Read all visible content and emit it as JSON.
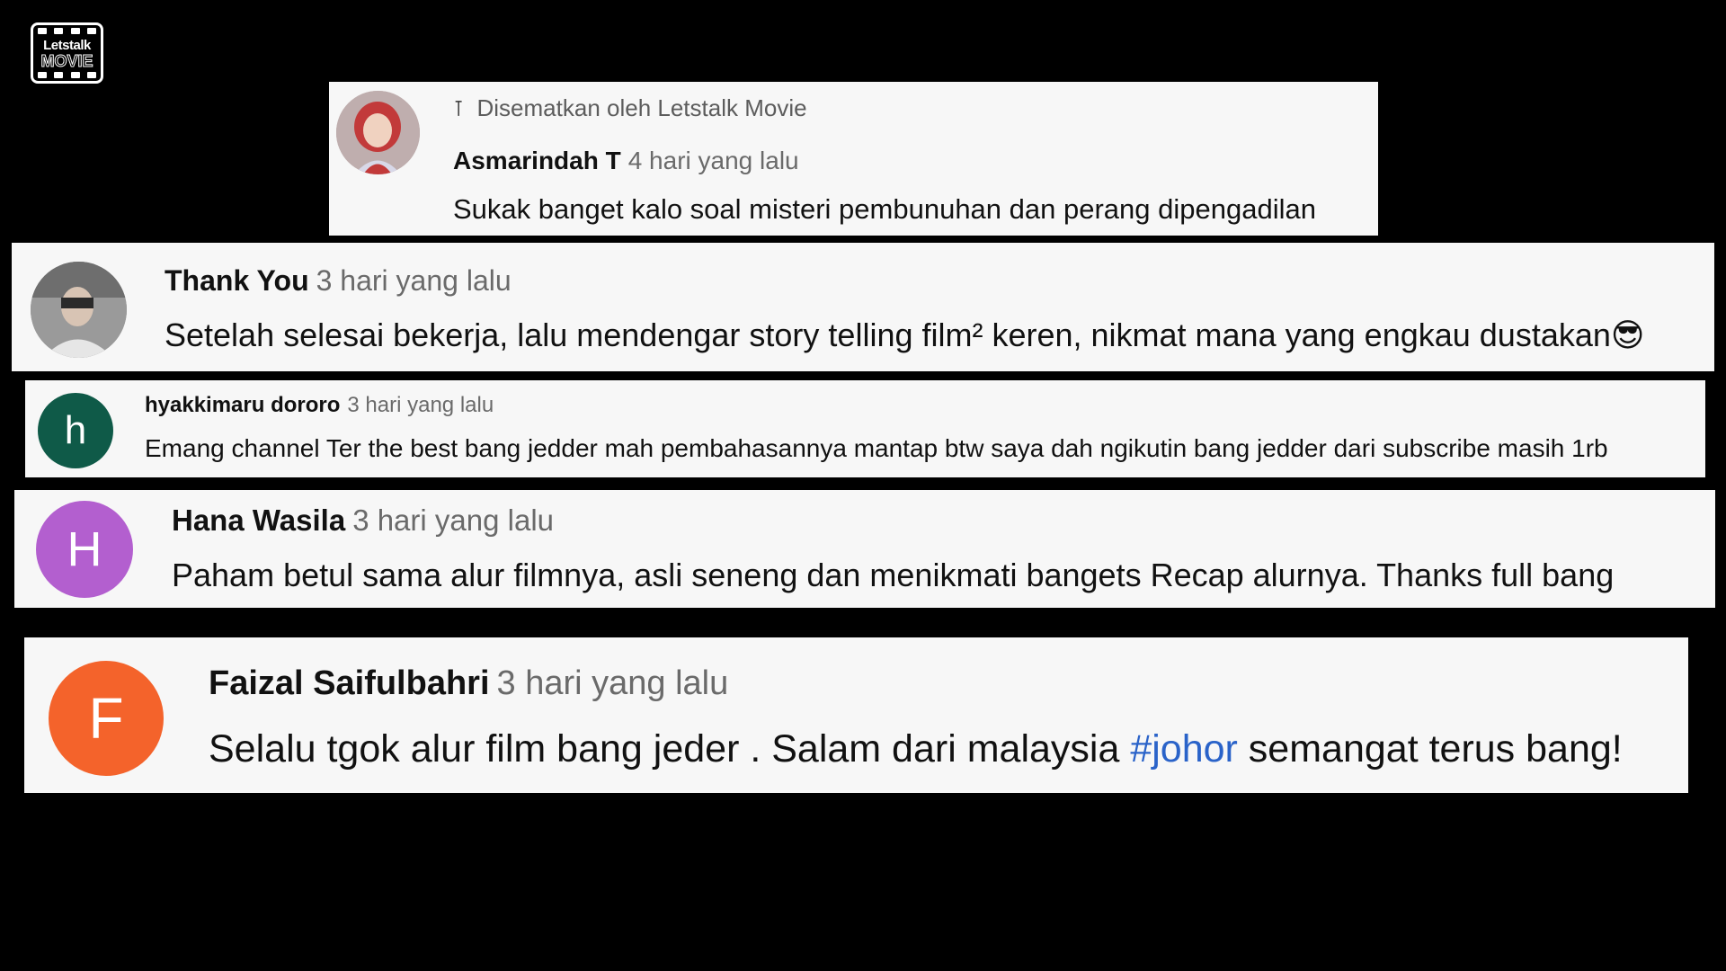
{
  "logo": {
    "line1": "Letstalk",
    "line2": "MOVIE"
  },
  "colors": {
    "background": "#000000",
    "card": "#f7f7f7",
    "hashtag": "#2a63c9",
    "avatar_h": "#0f5a48",
    "avatar_H": "#b35fcf",
    "avatar_F": "#f4632b"
  },
  "comments": [
    {
      "pinned_label": "Disematkan oleh Letstalk Movie",
      "pin_icon": "pin-icon",
      "author": "Asmarindah T",
      "time": "4 hari yang lalu",
      "text": "Sukak banget kalo soal misteri pembunuhan dan perang dipengadilan"
    },
    {
      "author": "Thank You",
      "time": "3 hari yang lalu",
      "text": "Setelah selesai bekerja, lalu mendengar story telling film² keren, nikmat mana yang engkau dustakan😎"
    },
    {
      "avatar_letter": "h",
      "author": "hyakkimaru dororo",
      "time": "3 hari yang lalu",
      "text": "Emang channel Ter the best bang jedder mah pembahasannya mantap btw saya dah ngikutin bang jedder dari subscribe masih 1rb"
    },
    {
      "avatar_letter": "H",
      "author": "Hana Wasila",
      "time": "3 hari yang lalu",
      "text": "Paham betul sama alur filmnya, asli seneng dan menikmati bangets Recap alurnya. Thanks full bang"
    },
    {
      "avatar_letter": "F",
      "author": "Faizal Saifulbahri",
      "time": "3 hari yang lalu",
      "text_before": "Selalu tgok alur film bang jeder . Salam dari malaysia ",
      "hashtag": "#johor",
      "text_after": " semangat terus bang!"
    }
  ]
}
